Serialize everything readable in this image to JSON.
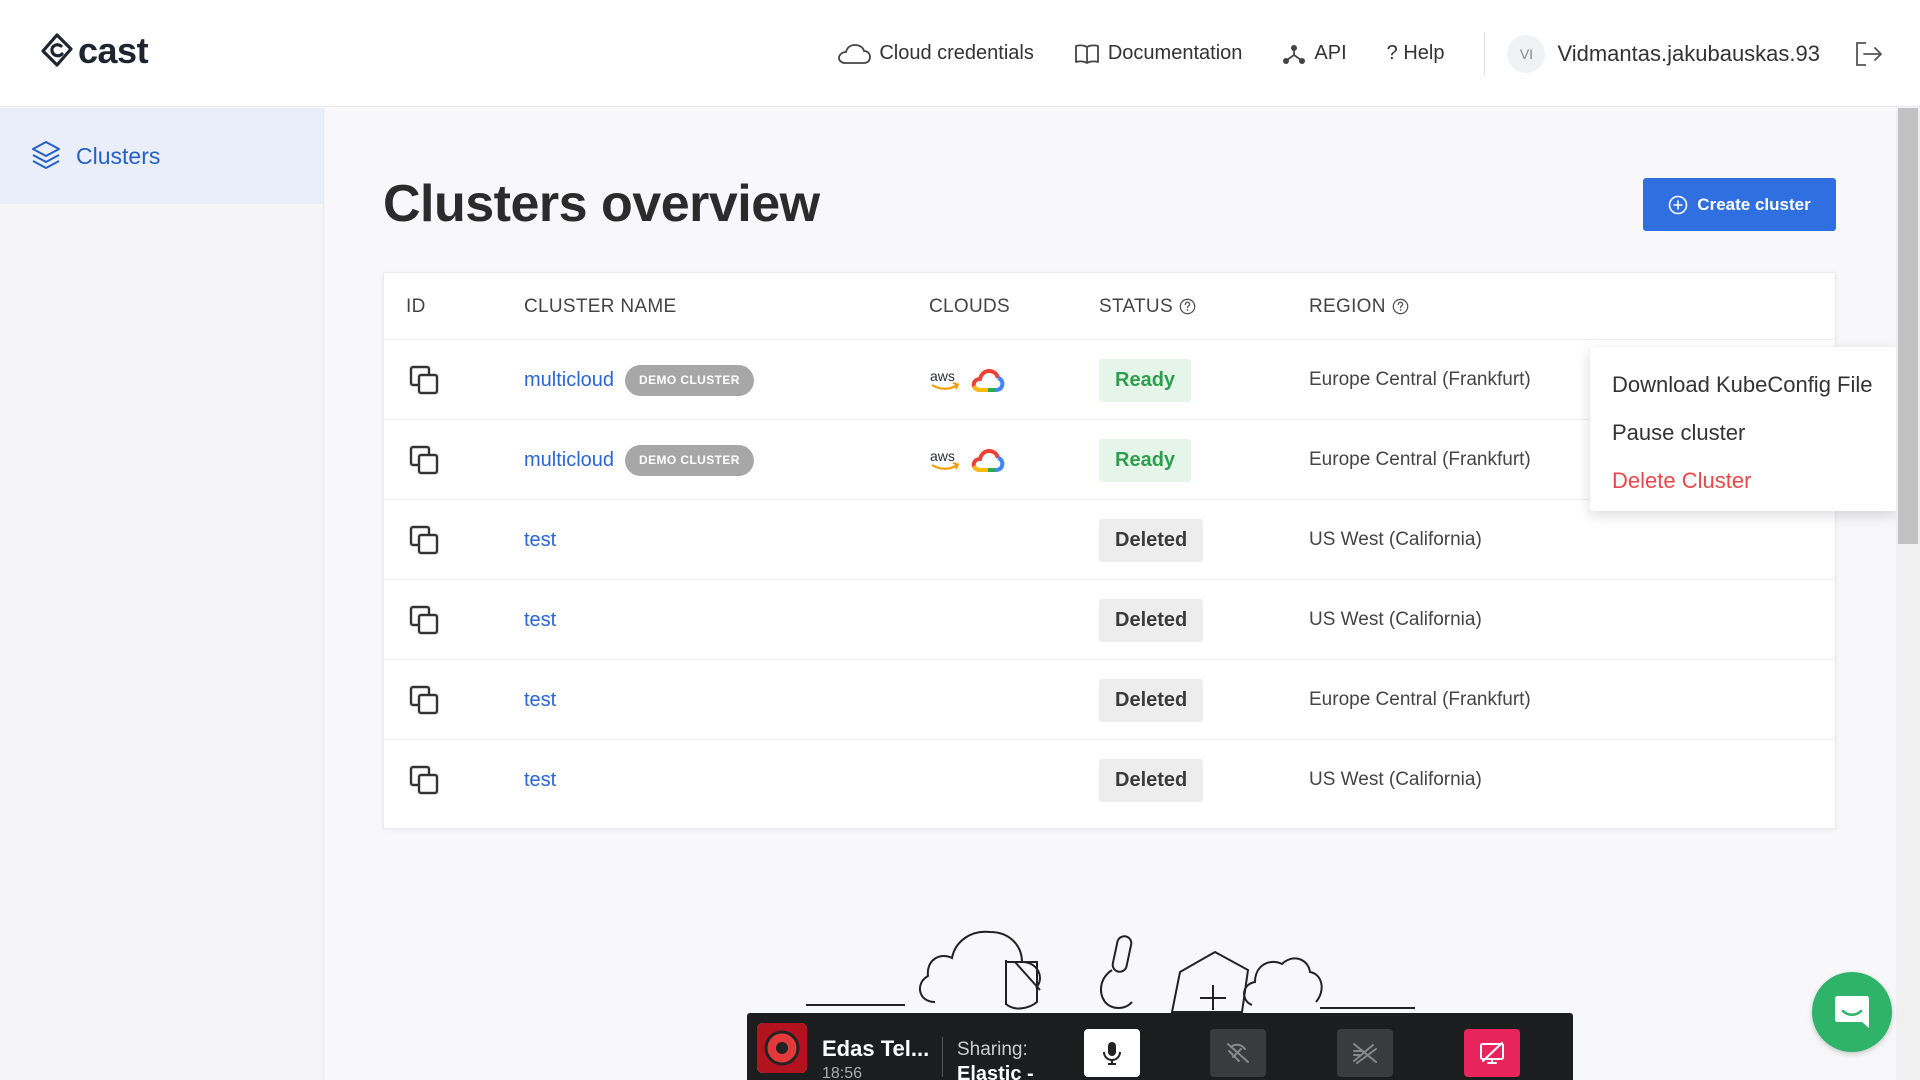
{
  "brand": {
    "name": "cast"
  },
  "nav": {
    "cloud_credentials": "Cloud credentials",
    "documentation": "Documentation",
    "api": "API",
    "help": "? Help"
  },
  "user": {
    "initials": "VI",
    "name": "Vidmantas.jakubauskas.93"
  },
  "sidebar": {
    "items": [
      {
        "label": "Clusters",
        "icon": "layers-icon",
        "active": true
      }
    ]
  },
  "page": {
    "title": "Clusters overview",
    "create_button": "Create cluster"
  },
  "table": {
    "headers": {
      "id": "ID",
      "name": "CLUSTER NAME",
      "clouds": "CLOUDS",
      "status": "STATUS",
      "region": "REGION"
    },
    "rows": [
      {
        "name": "multicloud",
        "badge": "DEMO CLUSTER",
        "clouds": [
          "aws",
          "gcp"
        ],
        "status": "Ready",
        "region": "Europe Central (Frankfurt)"
      },
      {
        "name": "multicloud",
        "badge": "DEMO CLUSTER",
        "clouds": [
          "aws",
          "gcp"
        ],
        "status": "Ready",
        "region": "Europe Central (Frankfurt)"
      },
      {
        "name": "test",
        "badge": "",
        "clouds": [],
        "status": "Deleted",
        "region": "US West (California)"
      },
      {
        "name": "test",
        "badge": "",
        "clouds": [],
        "status": "Deleted",
        "region": "US West (California)"
      },
      {
        "name": "test",
        "badge": "",
        "clouds": [],
        "status": "Deleted",
        "region": "Europe Central (Frankfurt)"
      },
      {
        "name": "test",
        "badge": "",
        "clouds": [],
        "status": "Deleted",
        "region": "US West (California)"
      }
    ]
  },
  "context_menu": {
    "download": "Download KubeConfig File",
    "pause": "Pause cluster",
    "delete": "Delete Cluster"
  },
  "share_bar": {
    "name": "Edas Tel...",
    "time": "18:56",
    "sharing_label": "Sharing:",
    "sharing_target": "Elastic -"
  },
  "colors": {
    "accent": "#2f6fe0",
    "ready": "#2e9e4c",
    "danger": "#e8484a",
    "chat": "#2fb36b",
    "stop_share": "#e8245c"
  }
}
